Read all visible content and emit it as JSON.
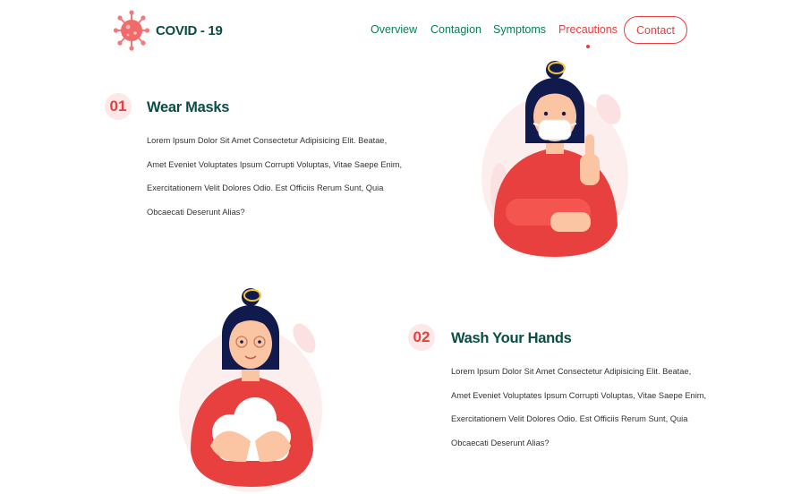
{
  "header": {
    "logo_text": "COVID - 19",
    "nav": [
      {
        "label": "Overview",
        "active": false
      },
      {
        "label": "Contagion",
        "active": false
      },
      {
        "label": "Symptoms",
        "active": false
      },
      {
        "label": "Precautions",
        "active": true
      }
    ],
    "contact_label": "Contact"
  },
  "sections": [
    {
      "number": "01",
      "title": "Wear Masks",
      "text": "Lorem Ipsum Dolor Sit Amet Consectetur Adipisicing Elit. Beatae, Amet Eveniet Voluptates Ipsum Corrupti Voluptas, Vitae Saepe Enim, Exercitationem Velit Dolores Odio. Est Officiis Rerum Sunt, Quia Obcaecati Deserunt Alias?"
    },
    {
      "number": "02",
      "title": "Wash Your Hands",
      "text": "Lorem Ipsum Dolor Sit Amet Consectetur Adipisicing Elit. Beatae, Amet Eveniet Voluptates Ipsum Corrupti Voluptas, Vitae Saepe Enim, Exercitationem Velit Dolores Odio. Est Officiis Rerum Sunt, Quia Obcaecati Deserunt Alias?"
    }
  ],
  "colors": {
    "brand_green": "#0b4d44",
    "nav_green": "#0b7d55",
    "accent_red": "#ea3d3d",
    "soft_pink": "#fde7e7"
  },
  "icons": [
    "virus-icon",
    "woman-wearing-mask-illustration",
    "woman-washing-hands-illustration"
  ]
}
